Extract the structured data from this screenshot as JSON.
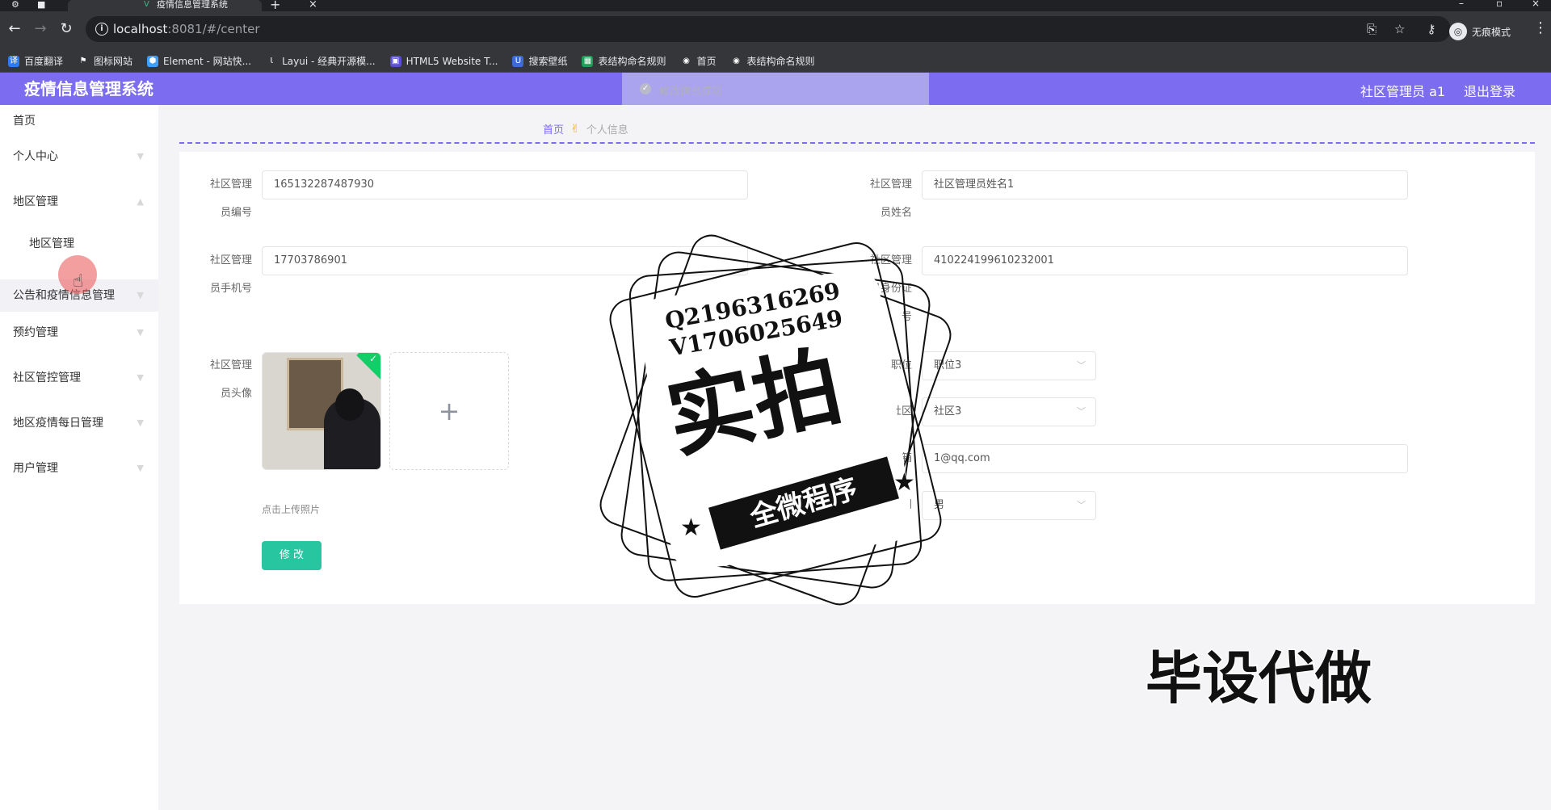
{
  "browser": {
    "tab_title": "疫情信息管理系统",
    "url_host": "localhost",
    "url_rest": ":8081/#/center",
    "incognito_label": "无痕模式",
    "bookmarks": [
      {
        "label": "百度翻译",
        "color": "#2b7cf6",
        "glyph": "译"
      },
      {
        "label": "图标网站",
        "color": "#35363a",
        "glyph": "⚑"
      },
      {
        "label": "Element - 网站快...",
        "color": "#409eff",
        "glyph": "⬢"
      },
      {
        "label": "Layui - 经典开源模...",
        "color": "#35363a",
        "glyph": "Ɩ"
      },
      {
        "label": "HTML5 Website T...",
        "color": "#5a4fcf",
        "glyph": "▣"
      },
      {
        "label": "搜索壁纸",
        "color": "#3b6cd4",
        "glyph": "U"
      },
      {
        "label": "表结构命名规则",
        "color": "#1e9e5a",
        "glyph": "▦"
      },
      {
        "label": "首页",
        "color": "#35363a",
        "glyph": "◉"
      },
      {
        "label": "表结构命名规则",
        "color": "#35363a",
        "glyph": "◉"
      }
    ]
  },
  "header": {
    "title": "疫情信息管理系统",
    "toast": "修改信息成功",
    "user": "社区管理员 a1",
    "logout": "退出登录"
  },
  "sidebar": {
    "items": [
      {
        "label": "首页"
      },
      {
        "label": "个人中心"
      },
      {
        "label": "地区管理"
      },
      {
        "label": "地区管理"
      },
      {
        "label": "公告和疫情信息管理"
      },
      {
        "label": "预约管理"
      },
      {
        "label": "社区管控管理"
      },
      {
        "label": "地区疫情每日管理"
      },
      {
        "label": "用户管理"
      }
    ]
  },
  "breadcrumb": {
    "home": "首页",
    "current": "个人信息"
  },
  "form": {
    "id_label_1": "社区管理",
    "id_label_2": "员编号",
    "id_value": "165132287487930",
    "name_label_1": "社区管理",
    "name_label_2": "员姓名",
    "name_value": "社区管理员姓名1",
    "phone_label_1": "社区管理",
    "phone_label_2": "员手机号",
    "phone_value": "17703786901",
    "idcard_label_1": "社区管理",
    "idcard_label_2": "员身份证",
    "idcard_label_3": "号",
    "idcard_value": "410224199610232001",
    "avatar_label_1": "社区管理",
    "avatar_label_2": "员头像",
    "position_label": "职位",
    "position_value": "职位3",
    "community_label": "社区",
    "community_value": "社区3",
    "email_label": "电子邮箱",
    "email_value": "1@qq.com",
    "gender_label": "性别",
    "gender_value": "男",
    "upload_hint": "点击上传照片",
    "submit": "修 改"
  },
  "watermark": {
    "line1": "Q2196316269",
    "line2": "V1706025649",
    "big": "实拍",
    "ribbon": "全微程序",
    "corner": "毕设代做"
  }
}
